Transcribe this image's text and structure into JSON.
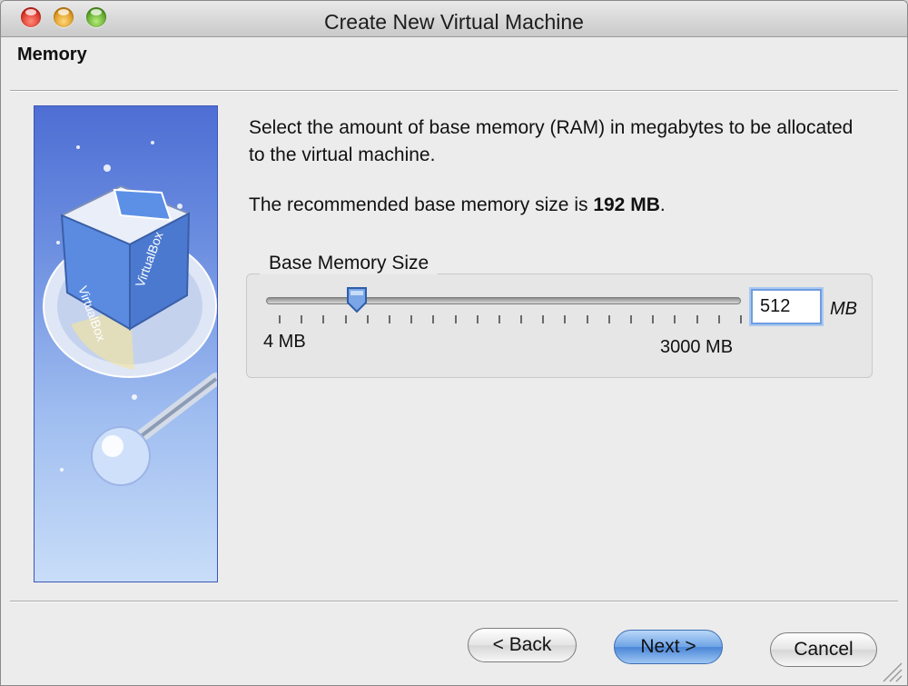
{
  "window": {
    "title": "Create New Virtual Machine",
    "controls": [
      "close",
      "minimize",
      "zoom"
    ]
  },
  "page": {
    "title": "Memory"
  },
  "content": {
    "description": "Select the amount of base memory (RAM) in megabytes to be allocated to the virtual machine.",
    "recommended_prefix": "The recommended base memory size is",
    "recommended_value": "192 MB",
    "recommended_suffix": ".",
    "group_label": "Base Memory Size",
    "slider": {
      "min_label": "4 MB",
      "max_label": "3000 MB",
      "min": 4,
      "max": 3000,
      "value": 512
    },
    "input_value": "512",
    "unit_label": "MB"
  },
  "buttons": {
    "back": "< Back",
    "next": "Next >",
    "cancel": "Cancel"
  },
  "colors": {
    "accent": "#4b86d8",
    "side_art": "#6d8fe0"
  },
  "icons": {
    "side_art": "virtualbox-logo-icon",
    "slider_thumb": "slider-thumb-icon",
    "resize_grip": "resize-grip-icon"
  }
}
